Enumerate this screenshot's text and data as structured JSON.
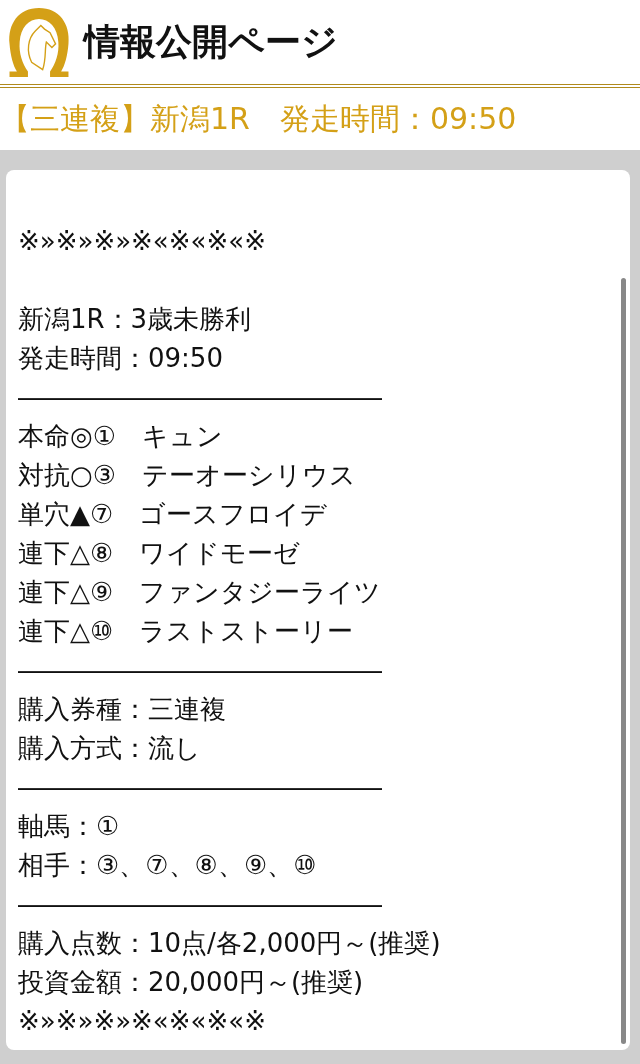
{
  "header": {
    "title": "情報公開ページ"
  },
  "subheader": {
    "title": "【三連複】新潟1R　発走時間：09:50"
  },
  "post": {
    "lines": [
      {
        "kind": "text",
        "text": "※»※»※»※«※«※«※"
      },
      {
        "kind": "blank"
      },
      {
        "kind": "text",
        "text": "新潟1R：3歳未勝利"
      },
      {
        "kind": "text",
        "text": "発走時間：09:50"
      },
      {
        "kind": "text",
        "text": "――――――――――――――"
      },
      {
        "kind": "text",
        "text": "本命◎①　キュン"
      },
      {
        "kind": "text",
        "text": "対抗○③　テーオーシリウス"
      },
      {
        "kind": "text",
        "text": "単穴▲⑦　ゴースフロイデ"
      },
      {
        "kind": "text",
        "text": "連下△⑧　ワイドモーゼ"
      },
      {
        "kind": "text",
        "text": "連下△⑨　ファンタジーライツ"
      },
      {
        "kind": "text",
        "text": "連下△⑩　ラストストーリー"
      },
      {
        "kind": "text",
        "text": "――――――――――――――"
      },
      {
        "kind": "text",
        "text": "購入券種：三連複"
      },
      {
        "kind": "text",
        "text": "購入方式：流し"
      },
      {
        "kind": "text",
        "text": "――――――――――――――"
      },
      {
        "kind": "text",
        "text": "軸馬：①"
      },
      {
        "kind": "text",
        "text": "相手：③、⑦、⑧、⑨、⑩"
      },
      {
        "kind": "text",
        "text": "――――――――――――――"
      },
      {
        "kind": "text",
        "text": "購入点数：10点/各2,000円～(推奨)"
      },
      {
        "kind": "text",
        "text": "投資金額：20,000円～(推奨)"
      },
      {
        "kind": "text",
        "text": "※»※»※»※«※«※«※"
      }
    ]
  }
}
